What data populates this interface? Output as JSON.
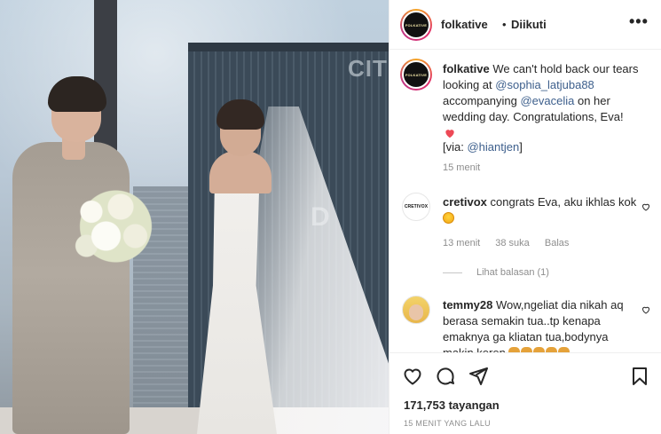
{
  "post": {
    "username": "folkative",
    "separator": "•",
    "follow_status": "Diikuti",
    "more_label": "•••",
    "avatar_text": "FOLKATIVE"
  },
  "caption": {
    "username": "folkative",
    "text_1": "We can't hold back our tears looking at",
    "mention_1": "@sophia_latjuba88",
    "text_2": "accompanying",
    "mention_2": "@evacelia",
    "text_3": "on her wedding day. Congratulations, Eva!",
    "via_prefix": "[via:",
    "via_mention": "@hiantjen",
    "via_suffix": "]",
    "time": "15 menit"
  },
  "comments": [
    {
      "username": "cretivox",
      "avatar_text": "CRETIVOX",
      "text": "congrats Eva, aku ikhlas kok",
      "time": "13 menit",
      "likes": "38 suka",
      "reply_label": "Balas",
      "view_replies": "Lihat balasan (1)"
    },
    {
      "username": "temmy28",
      "text": "Wow,ngeliat dia nikah aq berasa semakin tua..tp kenapa emaknya ga kliatan tua,bodynya makin keren"
    }
  ],
  "footer": {
    "likes_count": "171,753 tayangan",
    "time_ago": "15 MENIT YANG LALU"
  },
  "media": {
    "tower_sign": "CITI",
    "tower_sign_lower": "D"
  },
  "colors": {
    "link": "#3d5f8c",
    "heart_red": "#ed4956",
    "muted": "#8e8e8e",
    "text": "#262626"
  },
  "icons": [
    "heart-icon",
    "comment-icon",
    "share-icon",
    "bookmark-icon",
    "more-icon"
  ]
}
